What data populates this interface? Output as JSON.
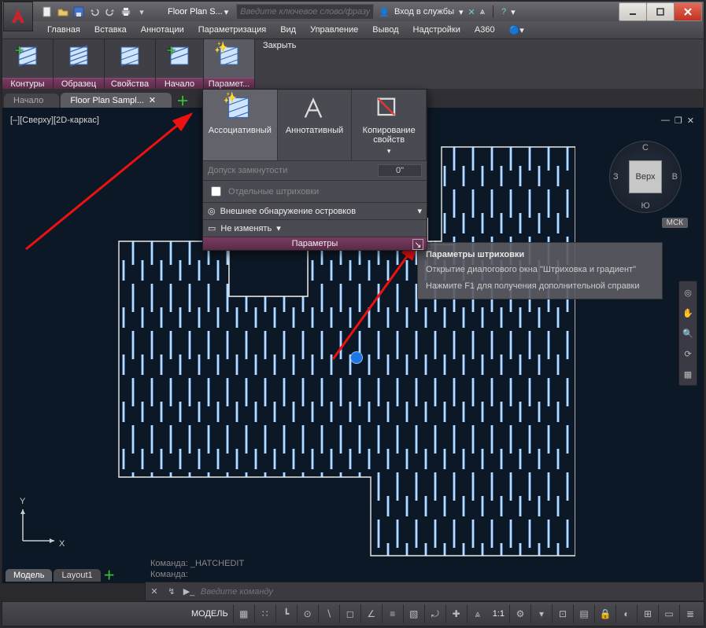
{
  "title": "Floor Plan S...",
  "search_placeholder": "Введите ключевое слово/фразу",
  "signin": "Вход в службы",
  "menu": [
    "Главная",
    "Вставка",
    "Аннотации",
    "Параметризация",
    "Вид",
    "Управление",
    "Вывод",
    "Надстройки",
    "A360"
  ],
  "ribbon": {
    "groups": [
      {
        "label": "Контуры"
      },
      {
        "label": "Образец"
      },
      {
        "label": "Свойства"
      },
      {
        "label": "Начало"
      },
      {
        "label": "Парамет..."
      }
    ],
    "close": "Закрыть"
  },
  "tabs": {
    "start": "Начало",
    "doc": "Floor Plan Sampl..."
  },
  "vp_label": "[–][Сверху][2D-каркас]",
  "viewcube": {
    "face": "Верх",
    "n": "С",
    "s": "Ю",
    "e": "В",
    "w": "З"
  },
  "ucs_badge": "МСК",
  "panel": {
    "assoc": "Ассоциативный",
    "annot": "Аннотативный",
    "copy": "Копирование свойств",
    "gap_label": "Допуск замкнутости",
    "gap_value": "0\"",
    "sep_hatch": "Отдельные штриховки",
    "island": "Внешнее обнаружение островков",
    "nochange": "Не изменять",
    "footer": "Параметры"
  },
  "tooltip": {
    "title": "Параметры штриховки",
    "line1": "Открытие диалогового окна \"Штриховка и градиент\"",
    "line2": "Нажмите F1 для получения дополнительной справки"
  },
  "cmd": {
    "hist1": "Команда: _HATCHEDIT",
    "hist2": "Команда:",
    "placeholder": "Введите команду"
  },
  "model_tabs": {
    "model": "Модель",
    "layout": "Layout1"
  },
  "status": {
    "model": "МОДЕЛЬ",
    "scale": "1:1"
  },
  "axes": {
    "x": "X",
    "y": "Y"
  }
}
